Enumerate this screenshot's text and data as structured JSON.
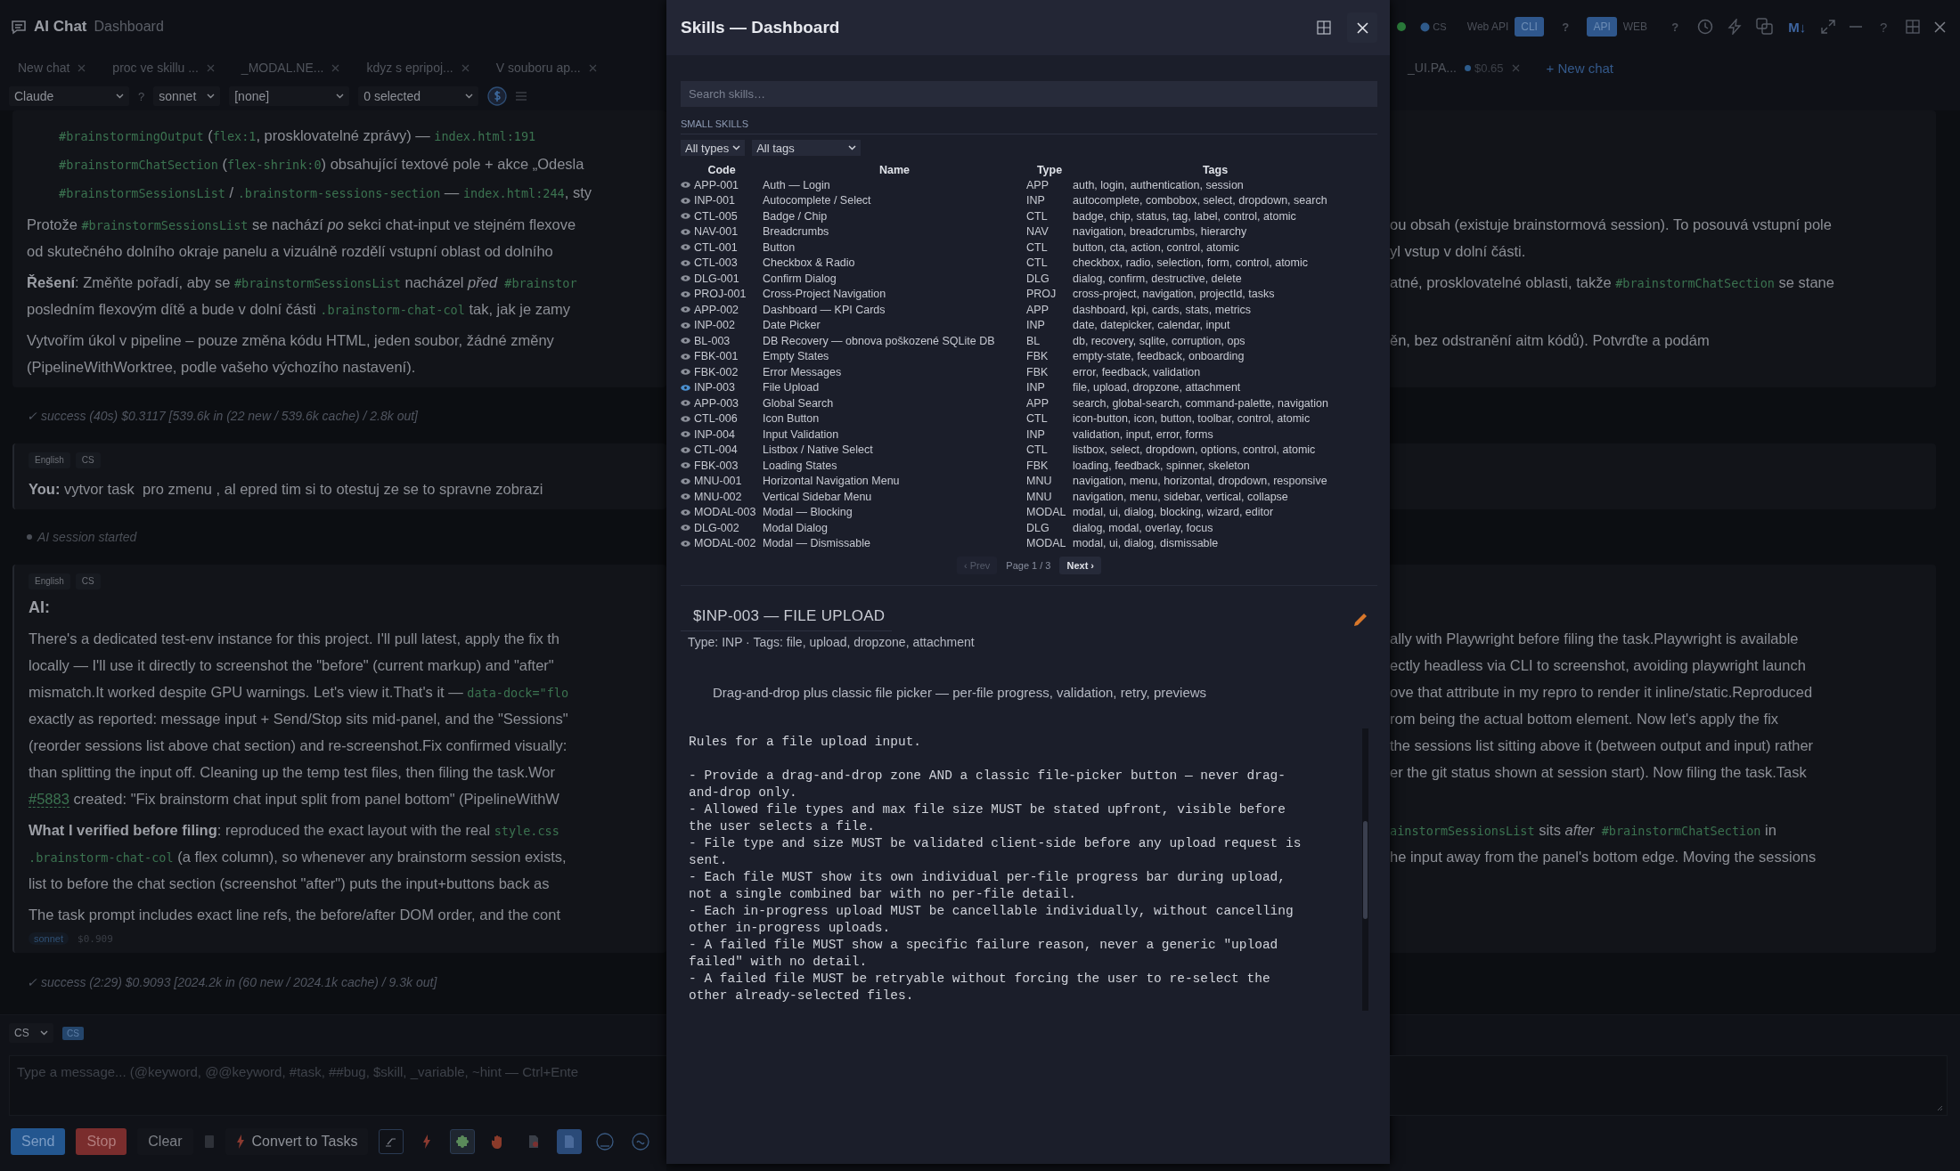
{
  "app": {
    "title": "AI Chat",
    "subtitle": "Dashboard"
  },
  "header_controls": {
    "language": "CS",
    "mode_switch": [
      {
        "label": "Web API",
        "selected": false
      },
      {
        "label": "CLI",
        "selected": true
      }
    ],
    "mode_help": "?",
    "api_switch": [
      {
        "label": "API",
        "selected": true
      },
      {
        "label": "WEB",
        "selected": false
      }
    ],
    "api_help": "?",
    "markdown_label": "M↓",
    "help": "?"
  },
  "tabs": [
    {
      "label": "New chat"
    },
    {
      "label": "proc ve skillu ..."
    },
    {
      "label": "_MODAL.NE..."
    },
    {
      "label": "kdyz s epripoj..."
    },
    {
      "label": "V souboru ap..."
    }
  ],
  "tabs_right": [
    {
      "label": "_UI.PA...",
      "cost": "$0.65"
    }
  ],
  "new_chat": "+ New chat",
  "toolbar": {
    "provider": "Claude",
    "provider_help": "?",
    "model": "sonnet",
    "preset": "[none]",
    "selection": "0 selected"
  },
  "messages": [
    {
      "kind": "card",
      "continued": true,
      "paragraphs": [
        {
          "kind": "list",
          "lines": [
            {
              "left": [
                {
                  "kind": "code",
                  "text": "#brainstormingOutput"
                },
                {
                  "kind": "text",
                  "text": " ("
                },
                {
                  "kind": "code",
                  "text": "flex:1"
                },
                {
                  "kind": "text",
                  "text": ", prosklovatelné zprávy) — "
                },
                {
                  "kind": "code",
                  "text": "index.html:191"
                }
              ]
            },
            {
              "left": [
                {
                  "kind": "code",
                  "text": "#brainstormChatSection"
                },
                {
                  "kind": "text",
                  "text": " ("
                },
                {
                  "kind": "code",
                  "text": "flex-shrink:0"
                },
                {
                  "kind": "text",
                  "text": ") obsahující textové pole + akce „Odesla"
                }
              ]
            },
            {
              "left": [
                {
                  "kind": "code",
                  "text": "#brainstormSessionsList"
                },
                {
                  "kind": "text",
                  "text": " / "
                },
                {
                  "kind": "code",
                  "text": ".brainstorm-sessions-section"
                },
                {
                  "kind": "text",
                  "text": " — "
                },
                {
                  "kind": "code",
                  "text": "index.html:244"
                },
                {
                  "kind": "text",
                  "text": ", sty"
                }
              ]
            }
          ]
        },
        {
          "kind": "text",
          "lines": [
            {
              "left": [
                {
                  "kind": "text",
                  "text": "Protože "
                },
                {
                  "kind": "code",
                  "text": "#brainstormSessionsList"
                },
                {
                  "kind": "text",
                  "text": " se nachází "
                },
                {
                  "kind": "italic",
                  "text": "po"
                },
                {
                  "kind": "text",
                  "text": " sekci chat-input ve stejném flexove"
                }
              ],
              "right": [
                {
                  "kind": "text",
                  "text": "ou obsah (existuje brainstormová session). To posouvá vstupní pole"
                }
              ]
            },
            {
              "left": [
                {
                  "kind": "text",
                  "text": "od skutečného dolního okraje panelu a vizuálně rozdělí vstupní oblast od dolního"
                }
              ],
              "right": [
                {
                  "kind": "text",
                  "text": "yl vstup v dolní části."
                }
              ]
            }
          ]
        },
        {
          "kind": "text",
          "lines": [
            {
              "left": [
                {
                  "kind": "bold",
                  "text": "Řešení"
                },
                {
                  "kind": "text",
                  "text": ": Změňte pořadí, aby se "
                },
                {
                  "kind": "code",
                  "text": "#brainstormSessionsList"
                },
                {
                  "kind": "text",
                  "text": " nacházel "
                },
                {
                  "kind": "italic",
                  "text": "před"
                },
                {
                  "kind": "code",
                  "text": " #brainstor"
                }
              ],
              "right": [
                {
                  "kind": "text",
                  "text": "atné, prosklovatelné oblasti, takže "
                },
                {
                  "kind": "code",
                  "text": "#brainstormChatSection"
                },
                {
                  "kind": "text",
                  "text": " se stane"
                }
              ]
            },
            {
              "left": [
                {
                  "kind": "text",
                  "text": "posledním flexovým dítě a bude v dolní části "
                },
                {
                  "kind": "code",
                  "text": ".brainstorm-chat-col"
                },
                {
                  "kind": "text",
                  "text": " tak, jak je zamy"
                }
              ]
            }
          ]
        },
        {
          "kind": "text",
          "lines": [
            {
              "left": [
                {
                  "kind": "text",
                  "text": "Vytvořím úkol v pipeline – pouze změna kódu HTML, jeden soubor, žádné změny"
                }
              ],
              "right": [
                {
                  "kind": "text",
                  "text": "ěn, bez odstranění aitm kódů). Potvrďte a podám"
                }
              ]
            },
            {
              "left": [
                {
                  "kind": "text",
                  "text": "(PipelineWithWorktree, podle vašeho výchozího nastavení)."
                }
              ]
            }
          ]
        }
      ]
    },
    {
      "kind": "status",
      "text": "✓ success (40s) $0.3117 [539.6k in (22 new / 539.6k cache) / 2.8k out]"
    },
    {
      "kind": "card",
      "continued": false,
      "tags": [
        "English",
        "CS"
      ],
      "paragraphs": [
        {
          "kind": "text",
          "lines": [
            {
              "left": [
                {
                  "kind": "bold",
                  "text": "You:"
                },
                {
                  "kind": "text",
                  "text": " vytvor task  pro zmenu , al epred tim si to otestuj ze se to spravne zobrazi"
                }
              ]
            }
          ]
        }
      ]
    },
    {
      "kind": "event",
      "text": "AI session started"
    },
    {
      "kind": "card",
      "continued": false,
      "tags": [
        "English",
        "CS"
      ],
      "label": "AI:",
      "paragraphs": [
        {
          "kind": "text",
          "lines": [
            {
              "left": [
                {
                  "kind": "text",
                  "text": "There's a dedicated test-env instance for this project. I'll pull latest, apply the fix th"
                }
              ],
              "right": [
                {
                  "kind": "text",
                  "text": "ally with Playwright before filing the task.Playwright is available"
                }
              ]
            },
            {
              "left": [
                {
                  "kind": "text",
                  "text": "locally — I'll use it directly to screenshot the \"before\" (current markup) and \"after\""
                }
              ],
              "right": [
                {
                  "kind": "text",
                  "text": "ectly headless via CLI to screenshot, avoiding playwright launch"
                }
              ]
            },
            {
              "left": [
                {
                  "kind": "text",
                  "text": "mismatch.It worked despite GPU warnings. Let's view it.That's it — "
                },
                {
                  "kind": "code",
                  "text": "data-dock=\"flo"
                }
              ],
              "right": [
                {
                  "kind": "text",
                  "text": "ove that attribute in my repro to render it inline/static.Reproduced"
                }
              ]
            },
            {
              "left": [
                {
                  "kind": "text",
                  "text": "exactly as reported: message input + Send/Stop sits mid-panel, and the \"Sessions\""
                }
              ],
              "right": [
                {
                  "kind": "text",
                  "text": "rom being the actual bottom element. Now let's apply the fix"
                }
              ]
            },
            {
              "left": [
                {
                  "kind": "text",
                  "text": "(reorder sessions list above chat section) and re-screenshot.Fix confirmed visually:"
                }
              ],
              "right": [
                {
                  "kind": "text",
                  "text": "the sessions list sitting above it (between output and input) rather"
                }
              ]
            },
            {
              "left": [
                {
                  "kind": "text",
                  "text": "than splitting the input off. Cleaning up the temp test files, then filing the task.Wor"
                }
              ],
              "right": [
                {
                  "kind": "text",
                  "text": "er the git status shown at session start). Now filing the task.Task"
                }
              ]
            },
            {
              "left": [
                {
                  "kind": "link",
                  "text": "#5883"
                },
                {
                  "kind": "text",
                  "text": " created: \"Fix brainstorm chat input split from panel bottom\" (PipelineWithW"
                }
              ]
            }
          ]
        },
        {
          "kind": "text",
          "lines": [
            {
              "left": [
                {
                  "kind": "bold",
                  "text": "What I verified before filing"
                },
                {
                  "kind": "text",
                  "text": ": reproduced the exact layout with the real "
                },
                {
                  "kind": "code",
                  "text": "style.css"
                }
              ],
              "right": [
                {
                  "kind": "code",
                  "text": "ainstormSessionsList"
                },
                {
                  "kind": "text",
                  "text": " sits "
                },
                {
                  "kind": "italic",
                  "text": "after"
                },
                {
                  "kind": "code",
                  "text": " #brainstormChatSection"
                },
                {
                  "kind": "text",
                  "text": " in"
                }
              ]
            },
            {
              "left": [
                {
                  "kind": "code",
                  "text": ".brainstorm-chat-col"
                },
                {
                  "kind": "text",
                  "text": " (a flex column), so whenever any brainstorm session exists,"
                }
              ],
              "right": [
                {
                  "kind": "text",
                  "text": "he input away from the panel's bottom edge. Moving the sessions"
                }
              ]
            },
            {
              "left": [
                {
                  "kind": "text",
                  "text": "list to before the chat section (screenshot \"after\") puts the input+buttons back as"
                }
              ]
            }
          ]
        },
        {
          "kind": "text",
          "lines": [
            {
              "left": [
                {
                  "kind": "text",
                  "text": "The task prompt includes exact line refs, the before/after DOM order, and the cont"
                }
              ]
            }
          ]
        }
      ],
      "footer": {
        "model": "sonnet",
        "cost": "$0.909"
      }
    },
    {
      "kind": "status",
      "text": "✓ success (2:29) $0.9093 [2024.2k in (60 new / 2024.1k cache) / 9.3k out]"
    }
  ],
  "composer": {
    "language": "CS",
    "language_badge": "CS",
    "placeholder": "Type a message... (@keyword, @@keyword, #task, ##bug, $skill, _variable, ~hint — Ctrl+Ente",
    "send": "Send",
    "stop": "Stop",
    "clear": "Clear",
    "convert": "Convert to Tasks",
    "tools": [
      {
        "kind": "terminal",
        "selected": false
      },
      {
        "kind": "bolt",
        "selected": false
      },
      {
        "kind": "puzzle",
        "selected": true
      },
      {
        "kind": "hand",
        "selected": false
      },
      {
        "kind": "document-alert",
        "selected": false
      },
      {
        "kind": "document",
        "selected": true
      },
      {
        "kind": "circle",
        "selected": false
      },
      {
        "kind": "wave",
        "selected": false
      }
    ]
  },
  "modal": {
    "title": "Skills — Dashboard",
    "search_placeholder": "Search skills…",
    "section": "SMALL SKILLS",
    "type_filter": "All types",
    "tag_filter": "All tags",
    "columns": [
      "Code",
      "Name",
      "Type",
      "Tags"
    ],
    "rows": [
      {
        "code": "APP-001",
        "name": "Auth — Login",
        "type": "APP",
        "tags": "auth, login, authentication, session",
        "selected": false
      },
      {
        "code": "INP-001",
        "name": "Autocomplete / Select",
        "type": "INP",
        "tags": "autocomplete, combobox, select, dropdown, search",
        "selected": false
      },
      {
        "code": "CTL-005",
        "name": "Badge / Chip",
        "type": "CTL",
        "tags": "badge, chip, status, tag, label, control, atomic",
        "selected": false
      },
      {
        "code": "NAV-001",
        "name": "Breadcrumbs",
        "type": "NAV",
        "tags": "navigation, breadcrumbs, hierarchy",
        "selected": false
      },
      {
        "code": "CTL-001",
        "name": "Button",
        "type": "CTL",
        "tags": "button, cta, action, control, atomic",
        "selected": false
      },
      {
        "code": "CTL-003",
        "name": "Checkbox & Radio",
        "type": "CTL",
        "tags": "checkbox, radio, selection, form, control, atomic",
        "selected": false
      },
      {
        "code": "DLG-001",
        "name": "Confirm Dialog",
        "type": "DLG",
        "tags": "dialog, confirm, destructive, delete",
        "selected": false
      },
      {
        "code": "PROJ-001",
        "name": "Cross-Project Navigation",
        "type": "PROJ",
        "tags": "cross-project, navigation, projectId, tasks",
        "selected": false
      },
      {
        "code": "APP-002",
        "name": "Dashboard — KPI Cards",
        "type": "APP",
        "tags": "dashboard, kpi, cards, stats, metrics",
        "selected": false
      },
      {
        "code": "INP-002",
        "name": "Date Picker",
        "type": "INP",
        "tags": "date, datepicker, calendar, input",
        "selected": false
      },
      {
        "code": "BL-003",
        "name": "DB Recovery — obnova poškozené SQLite DB",
        "type": "BL",
        "tags": "db, recovery, sqlite, corruption, ops",
        "selected": false
      },
      {
        "code": "FBK-001",
        "name": "Empty States",
        "type": "FBK",
        "tags": "empty-state, feedback, onboarding",
        "selected": false
      },
      {
        "code": "FBK-002",
        "name": "Error Messages",
        "type": "FBK",
        "tags": "error, feedback, validation",
        "selected": false
      },
      {
        "code": "INP-003",
        "name": "File Upload",
        "type": "INP",
        "tags": "file, upload, dropzone, attachment",
        "selected": true
      },
      {
        "code": "APP-003",
        "name": "Global Search",
        "type": "APP",
        "tags": "search, global-search, command-palette, navigation",
        "selected": false
      },
      {
        "code": "CTL-006",
        "name": "Icon Button",
        "type": "CTL",
        "tags": "icon-button, icon, button, toolbar, control, atomic",
        "selected": false
      },
      {
        "code": "INP-004",
        "name": "Input Validation",
        "type": "INP",
        "tags": "validation, input, error, forms",
        "selected": false
      },
      {
        "code": "CTL-004",
        "name": "Listbox / Native Select",
        "type": "CTL",
        "tags": "listbox, select, dropdown, options, control, atomic",
        "selected": false
      },
      {
        "code": "FBK-003",
        "name": "Loading States",
        "type": "FBK",
        "tags": "loading, feedback, spinner, skeleton",
        "selected": false
      },
      {
        "code": "MNU-001",
        "name": "Horizontal Navigation Menu",
        "type": "MNU",
        "tags": "navigation, menu, horizontal, dropdown, responsive",
        "selected": false
      },
      {
        "code": "MNU-002",
        "name": "Vertical Sidebar Menu",
        "type": "MNU",
        "tags": "navigation, menu, sidebar, vertical, collapse",
        "selected": false
      },
      {
        "code": "MODAL-003",
        "name": "Modal — Blocking",
        "type": "MODAL",
        "tags": "modal, ui, dialog, blocking, wizard, editor",
        "selected": false
      },
      {
        "code": "DLG-002",
        "name": "Modal Dialog",
        "type": "DLG",
        "tags": "dialog, modal, overlay, focus",
        "selected": false
      },
      {
        "code": "MODAL-002",
        "name": "Modal — Dismissable",
        "type": "MODAL",
        "tags": "modal, ui, dialog, dismissable",
        "selected": false
      }
    ],
    "pager": {
      "prev": "‹ Prev",
      "prev_disabled": true,
      "page": "Page 1 / 3",
      "next": "Next ›"
    },
    "detail": {
      "title": "$INP-003 — FILE UPLOAD",
      "meta": "Type: INP · Tags: file, upload, dropzone, attachment",
      "description": "Drag-and-drop plus classic file picker — per-file progress, validation, retry, previews",
      "body": "Rules for a file upload input.\n\n- Provide a drag-and-drop zone AND a classic file-picker button — never drag-\nand-drop only.\n- Allowed file types and max file size MUST be stated upfront, visible before\nthe user selects a file.\n- File type and size MUST be validated client-side before any upload request is\nsent.\n- Each file MUST show its own individual per-file progress bar during upload,\nnot a single combined bar with no per-file detail.\n- Each in-progress upload MUST be cancellable individually, without cancelling\nother in-progress uploads.\n- A failed file MUST show a specific failure reason, never a generic \"upload\nfailed\" with no detail.\n- A failed file MUST be retryable without forcing the user to re-select the\nother already-selected files."
    }
  }
}
